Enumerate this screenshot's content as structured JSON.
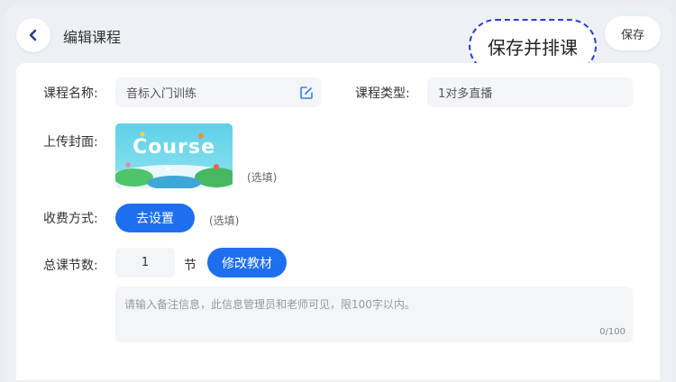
{
  "header": {
    "title": "编辑课程",
    "save_schedule_label": "保存并排课",
    "save_label": "保存"
  },
  "form": {
    "course_name": {
      "label": "课程名称:",
      "value": "音标入门训练"
    },
    "course_type": {
      "label": "课程类型:",
      "value": "1对多直播"
    },
    "cover": {
      "label": "上传封面:",
      "image_text": "Course",
      "optional": "(选填)"
    },
    "fee": {
      "label": "收费方式:",
      "button": "去设置",
      "optional": "(选填)"
    },
    "lessons": {
      "label": "总课节数:",
      "value": "1",
      "unit": "节",
      "button": "修改教材"
    },
    "notes": {
      "placeholder": "请输入备注信息，此信息管理员和老师可见，限100字以内。",
      "counter": "0/100"
    }
  },
  "colors": {
    "accent": "#1e6ff0",
    "highlight_border": "#2d3ed6",
    "background": "#edf1f6"
  },
  "icons": {
    "back": "chevron-left-icon",
    "edit": "edit-icon"
  }
}
